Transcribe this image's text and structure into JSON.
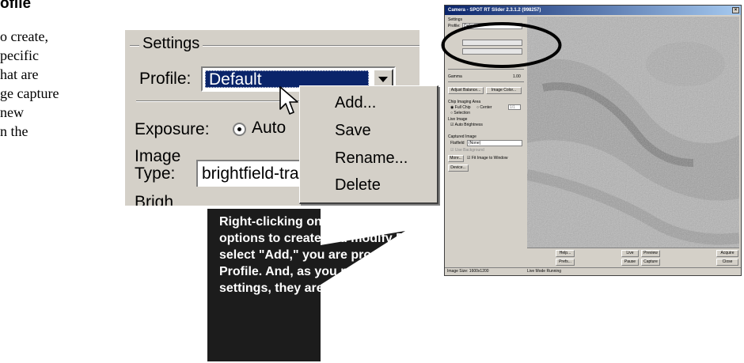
{
  "doc": {
    "heading": "ofile",
    "lines": [
      "o create,",
      "pecific",
      "hat are",
      "ge capture",
      "new",
      "n the"
    ]
  },
  "zoom": {
    "group_label": "Settings",
    "profile_label": "Profile:",
    "profile_value": "Default",
    "exposure_label": "Exposure:",
    "exposure_option": "Auto",
    "image_type_label_1": "Image",
    "image_type_label_2": "Type:",
    "image_type_value": "brightfield-tra",
    "cut_label": "Brigh"
  },
  "context_menu": {
    "items": [
      "Add...",
      "Save",
      "Rename...",
      "Delete"
    ]
  },
  "callout": {
    "text": "Right-clicking on the Profile box gives you options to create and modify Profiles.  When you select \"Add,\" you are prompted to name the new Profile.  And, as you modify view and capture settings, they are saved to that Profile."
  },
  "window": {
    "title": "Camera - SPOT RT Slider 2.3.1.2  (998257)",
    "settings_label": "Settings",
    "profile_label": "Profile:",
    "profile_value": "Default",
    "gamma_label": "Gamma",
    "gamma_value": "1.00",
    "btn_adjust": "Adjust Balance...",
    "btn_image": "Image Color...",
    "chip_area_label": "Chip Imaging Area",
    "full_chip": "Full Chip",
    "center": "Center",
    "center_value": "1/1",
    "selection": "Selection",
    "live_image_label": "Live Image",
    "auto_brightness": "Auto Brightness",
    "captured_label": "Captured Image",
    "flatfield_label": "Flatfield",
    "flatfield_value": "(None)",
    "bg_subtraction": "Use Background",
    "more_btn": "More...",
    "fit_label": "Fit Image to Window",
    "device_btn": "Device...",
    "help_btn": "Help...",
    "prefs_btn": "Prefs...",
    "live_btn": "Live",
    "preview_btn": "Preview",
    "acquire_btn": "Acquire",
    "pause_btn": "Pause",
    "capture_btn": "Capture",
    "close_btn": "Close",
    "status_size": "Image Size: 1600x1200",
    "status_mode": "Live Mode Running"
  },
  "colors": {
    "selection_blue": "#0a246a",
    "callout_bg": "#1c1c1c",
    "dialog_gray": "#d4d0c8"
  }
}
